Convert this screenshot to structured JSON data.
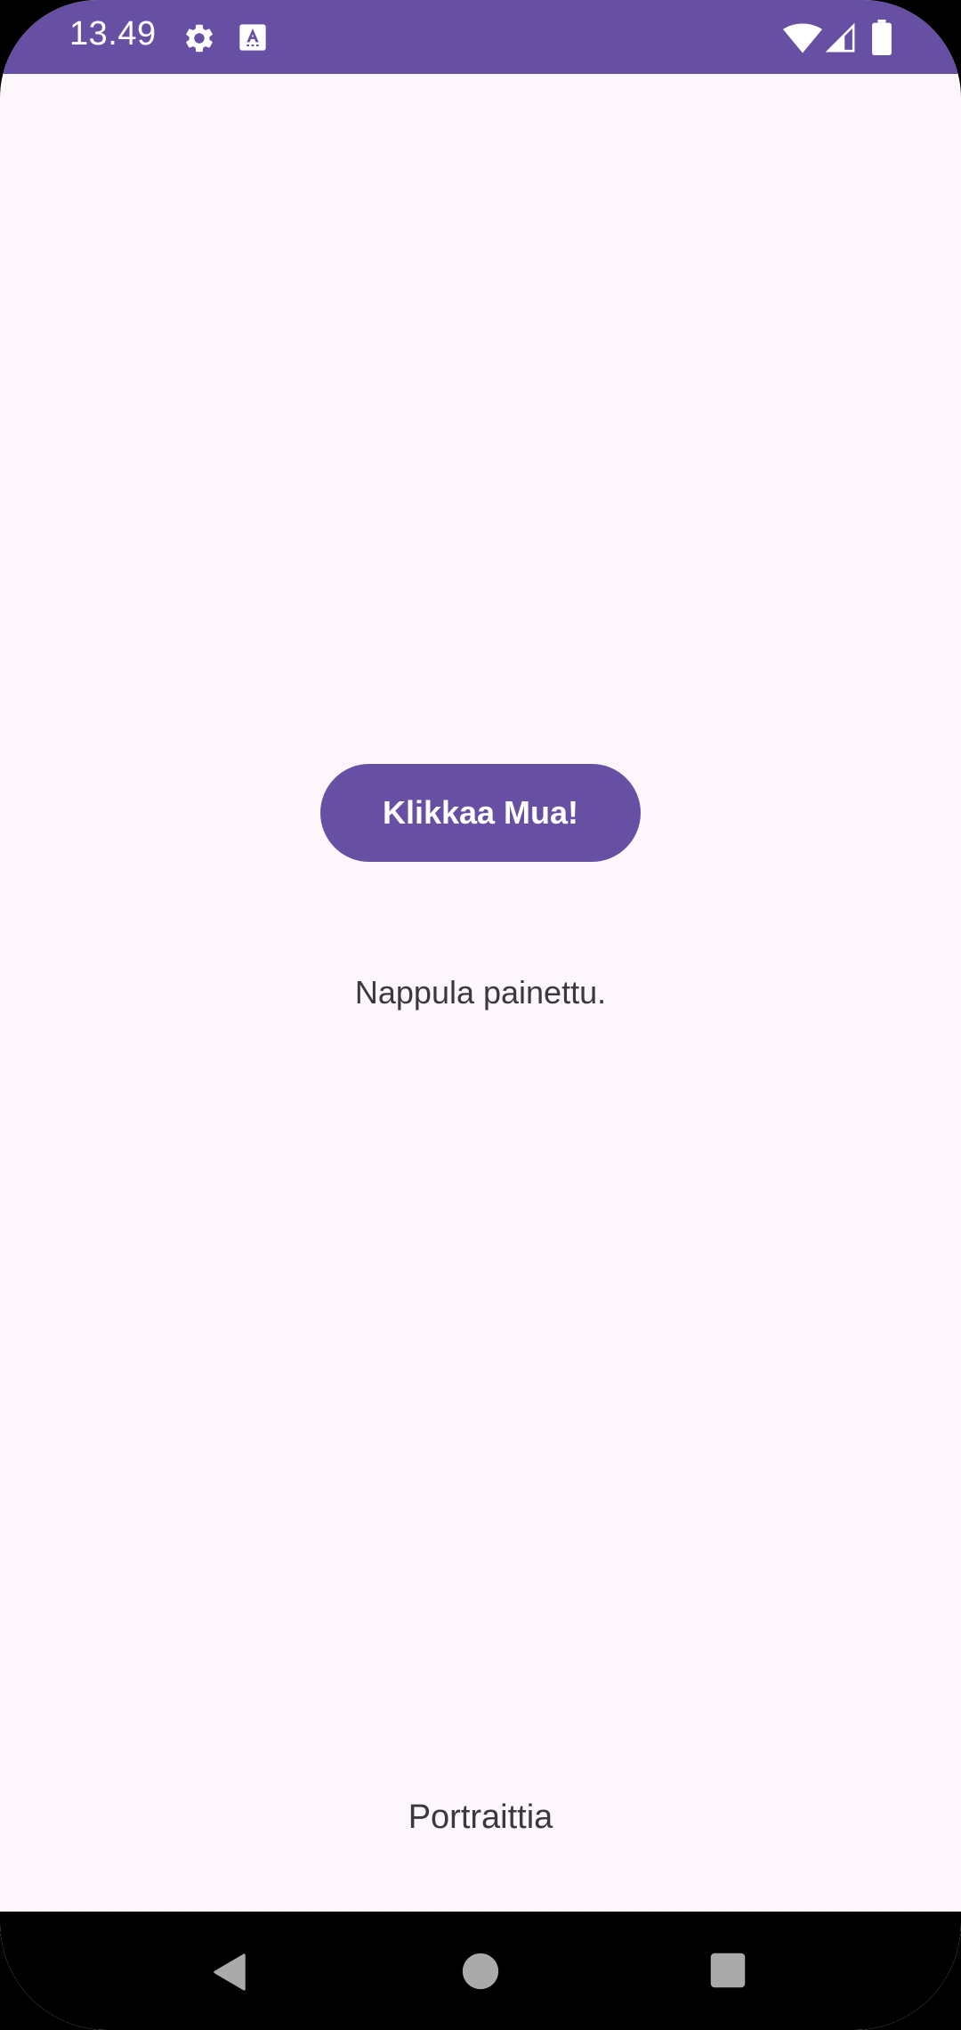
{
  "status_bar": {
    "time": "13.49",
    "background_color": "#6750A4",
    "icons": [
      "gear-icon",
      "keyboard-icon",
      "wifi-icon",
      "signal-icon",
      "battery-icon"
    ]
  },
  "main": {
    "button_label": "Klikkaa Mua!",
    "status_text": "Nappula painettu.",
    "orientation_text": "Portraittia"
  },
  "nav_bar": {
    "icons": [
      "back-icon",
      "home-icon",
      "recents-icon"
    ]
  },
  "colors": {
    "accent": "#6750A4",
    "background": "#FDF7FB",
    "text": "#3B3840"
  }
}
